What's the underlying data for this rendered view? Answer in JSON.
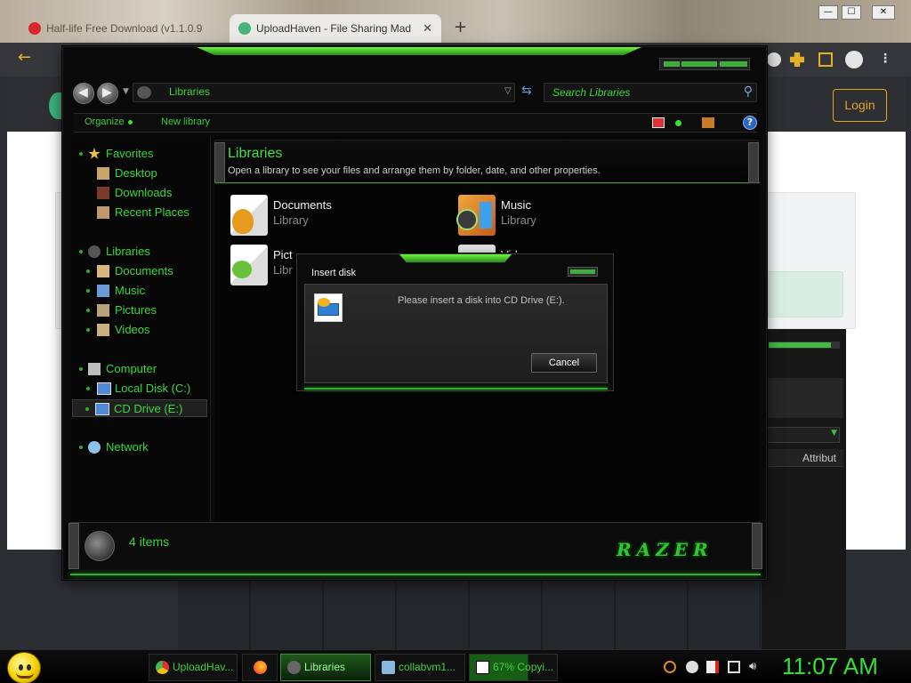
{
  "browser": {
    "tabs": [
      {
        "title": "Half-life Free Download (v1.1.0.9",
        "state": "inactive"
      },
      {
        "title": "UploadHaven - File Sharing Mad",
        "state": "active"
      }
    ],
    "tab_close": "✕",
    "new_tab": "+",
    "back_glyph": "←",
    "window_controls": {
      "minimize": "—",
      "maximize": "☐",
      "close": "✕"
    },
    "login_label": "Login",
    "attribute_header": "Attribut"
  },
  "explorer": {
    "address": "Libraries",
    "search_placeholder": "Search Libraries",
    "toolbar": {
      "organize": "Organize",
      "new_library": "New library",
      "help": "?"
    },
    "nav": {
      "favorites": {
        "label": "Favorites",
        "items": [
          "Desktop",
          "Downloads",
          "Recent Places"
        ]
      },
      "libraries": {
        "label": "Libraries",
        "items": [
          "Documents",
          "Music",
          "Pictures",
          "Videos"
        ]
      },
      "computer": {
        "label": "Computer",
        "items": [
          "Local Disk (C:)",
          "CD Drive (E:)"
        ]
      },
      "network": {
        "label": "Network"
      }
    },
    "header": {
      "title": "Libraries",
      "description": "Open a library to see your files and arrange them by folder, date, and other properties."
    },
    "libraries": [
      {
        "name": "Documents",
        "type": "Library"
      },
      {
        "name": "Music",
        "type": "Library"
      },
      {
        "name": "Pict",
        "type": "Libr"
      },
      {
        "name": "Vid",
        "type": ""
      }
    ],
    "status": {
      "count": "4 items",
      "brand": "RAZER"
    }
  },
  "dialog": {
    "title": "Insert disk",
    "message": "Please insert a disk into CD Drive (E:).",
    "cancel_label": "Cancel"
  },
  "taskbar": {
    "items": [
      {
        "label": "UploadHav...",
        "icon": "chrome-icon"
      },
      {
        "label": "",
        "icon": "firefox-icon"
      },
      {
        "label": "Libraries",
        "icon": "explorer-icon",
        "active": true
      },
      {
        "label": "collabvm1...",
        "icon": "network-app-icon"
      },
      {
        "label": "67% Copyi...",
        "icon": "7zip-icon",
        "progress": 0.67
      }
    ],
    "clock": "11:07 AM"
  },
  "colors": {
    "accent_green": "#39d839",
    "browser_accent": "#e0a625"
  }
}
